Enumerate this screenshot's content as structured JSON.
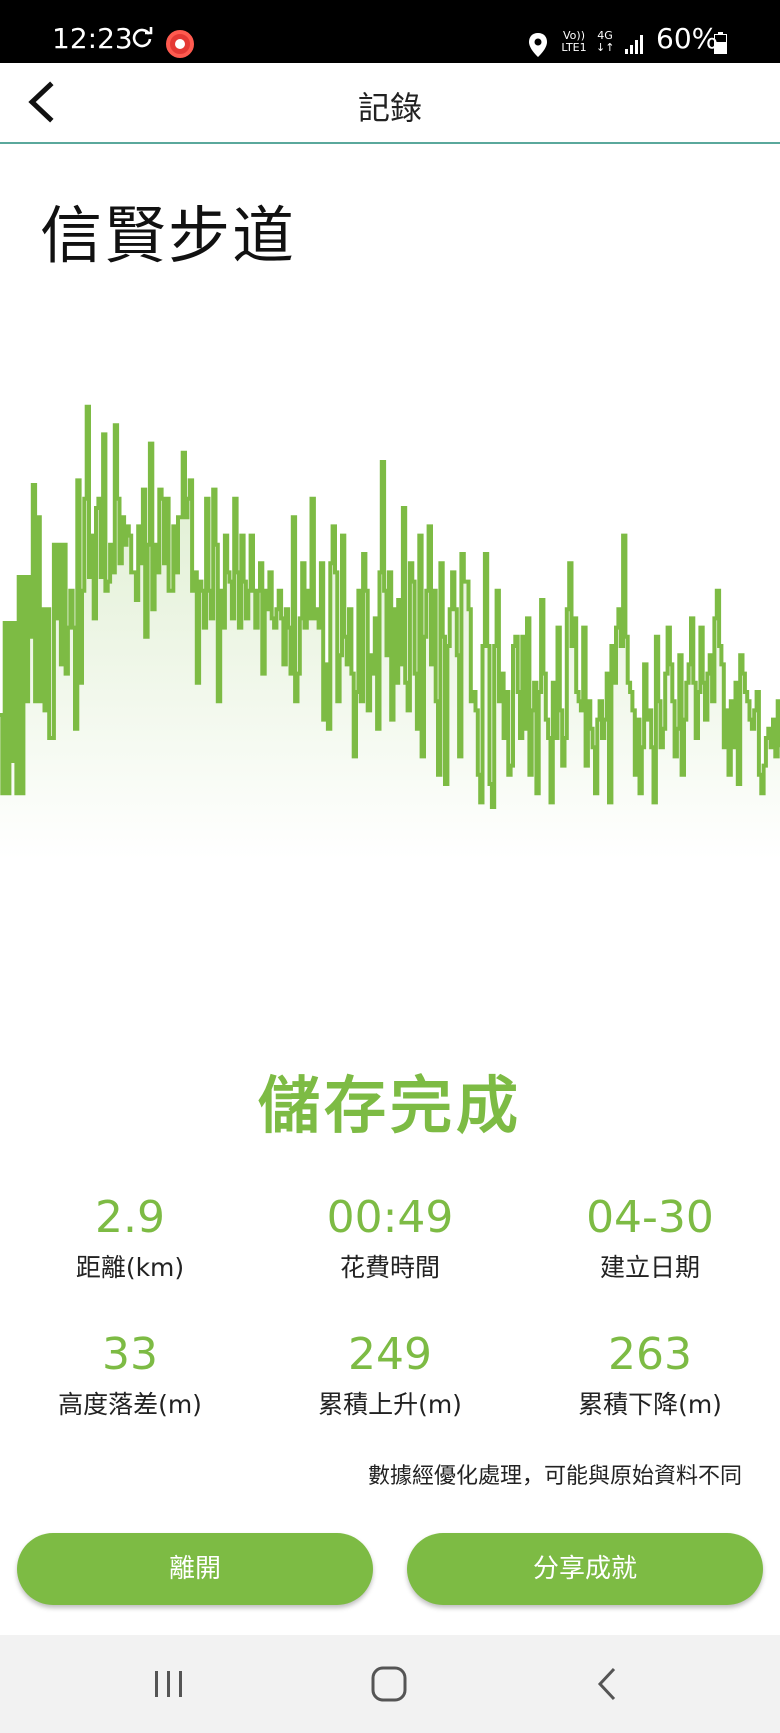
{
  "status_bar": {
    "time": "12:23",
    "volte_line1": "Vo))",
    "volte_line2": "LTE1",
    "network_line1": "4G",
    "network_line2": "↓↑",
    "battery": "60%"
  },
  "header": {
    "title": "記錄"
  },
  "route": {
    "name": "信賢步道"
  },
  "status_heading": "儲存完成",
  "stats": [
    {
      "value": "2.9",
      "label": "距離(km)"
    },
    {
      "value": "00:49",
      "label": "花費時間"
    },
    {
      "value": "04-30",
      "label": "建立日期"
    },
    {
      "value": "33",
      "label": "高度落差(m)"
    },
    {
      "value": "249",
      "label": "累積上升(m)"
    },
    {
      "value": "263",
      "label": "累積下降(m)"
    }
  ],
  "note": "數據經優化處理，可能與原始資料不同",
  "buttons": {
    "leave": "離開",
    "share": "分享成就"
  },
  "colors": {
    "accent": "#7dbb44",
    "header_divider": "#5aa89c",
    "status_bar": "#000000",
    "nav_bar": "#f2f2f2"
  },
  "icons": [
    "sync-icon",
    "record-icon",
    "location-icon",
    "signal-icon",
    "battery-icon",
    "back-arrow-icon",
    "recent-apps-icon",
    "home-icon",
    "nav-back-icon"
  ],
  "chart_data": {
    "type": "area",
    "values": [
      0.25,
      0.08,
      0.45,
      0.08,
      0.45,
      0.15,
      0.45,
      0.08,
      0.55,
      0.08,
      0.55,
      0.28,
      0.55,
      0.42,
      0.75,
      0.28,
      0.68,
      0.28,
      0.48,
      0.26,
      0.48,
      0.2,
      0.2,
      0.62,
      0.46,
      0.62,
      0.36,
      0.62,
      0.34,
      0.44,
      0.52,
      0.44,
      0.22,
      0.76,
      0.32,
      0.52,
      0.72,
      0.92,
      0.55,
      0.64,
      0.46,
      0.7,
      0.72,
      0.55,
      0.86,
      0.52,
      0.54,
      0.62,
      0.56,
      0.88,
      0.72,
      0.58,
      0.68,
      0.62,
      0.66,
      0.64,
      0.56,
      0.56,
      0.5,
      0.66,
      0.58,
      0.74,
      0.42,
      0.62,
      0.84,
      0.48,
      0.62,
      0.56,
      0.74,
      0.72,
      0.58,
      0.72,
      0.52,
      0.52,
      0.66,
      0.56,
      0.68,
      0.68,
      0.82,
      0.68,
      0.72,
      0.76,
      0.52,
      0.56,
      0.32,
      0.54,
      0.52,
      0.44,
      0.72,
      0.52,
      0.46,
      0.74,
      0.62,
      0.28,
      0.52,
      0.44,
      0.64,
      0.56,
      0.54,
      0.46,
      0.72,
      0.56,
      0.44,
      0.64,
      0.54,
      0.46,
      0.52,
      0.64,
      0.52,
      0.44,
      0.52,
      0.58,
      0.34,
      0.52,
      0.48,
      0.56,
      0.46,
      0.44,
      0.48,
      0.52,
      0.46,
      0.36,
      0.48,
      0.44,
      0.34,
      0.68,
      0.28,
      0.34,
      0.46,
      0.58,
      0.44,
      0.52,
      0.46,
      0.72,
      0.46,
      0.48,
      0.44,
      0.58,
      0.24,
      0.36,
      0.22,
      0.58,
      0.66,
      0.56,
      0.28,
      0.38,
      0.64,
      0.42,
      0.36,
      0.48,
      0.34,
      0.16,
      0.3,
      0.52,
      0.28,
      0.6,
      0.52,
      0.26,
      0.38,
      0.34,
      0.46,
      0.22,
      0.56,
      0.8,
      0.52,
      0.38,
      0.56,
      0.24,
      0.48,
      0.32,
      0.5,
      0.36,
      0.7,
      0.32,
      0.26,
      0.58,
      0.54,
      0.34,
      0.22,
      0.64,
      0.16,
      0.42,
      0.52,
      0.66,
      0.36,
      0.52,
      0.28,
      0.12,
      0.58,
      0.42,
      0.1,
      0.4,
      0.48,
      0.56,
      0.48,
      0.38,
      0.16,
      0.6,
      0.54,
      0.54,
      0.48,
      0.28,
      0.3,
      0.26,
      0.12,
      0.06,
      0.4,
      0.6,
      0.4,
      0.1,
      0.05,
      0.4,
      0.52,
      0.28,
      0.34,
      0.2,
      0.3,
      0.12,
      0.14,
      0.4,
      0.42,
      0.3,
      0.2,
      0.42,
      0.22,
      0.46,
      0.12,
      0.26,
      0.32,
      0.08,
      0.3,
      0.5,
      0.34,
      0.24,
      0.2,
      0.06,
      0.32,
      0.2,
      0.44,
      0.26,
      0.14,
      0.2,
      0.48,
      0.58,
      0.4,
      0.46,
      0.3,
      0.28,
      0.26,
      0.44,
      0.14,
      0.28,
      0.22,
      0.18,
      0.08,
      0.24,
      0.28,
      0.2,
      0.24,
      0.34,
      0.06,
      0.4,
      0.32,
      0.44,
      0.48,
      0.4,
      0.64,
      0.42,
      0.32,
      0.3,
      0.26,
      0.12,
      0.24,
      0.08,
      0.18,
      0.36,
      0.24,
      0.26,
      0.18,
      0.06,
      0.42,
      0.28,
      0.18,
      0.22,
      0.34,
      0.44,
      0.36,
      0.28,
      0.16,
      0.22,
      0.38,
      0.12,
      0.24,
      0.32,
      0.36,
      0.46,
      0.32,
      0.2,
      0.3,
      0.44,
      0.32,
      0.24,
      0.34,
      0.38,
      0.28,
      0.46,
      0.52,
      0.4,
      0.36,
      0.18,
      0.26,
      0.12,
      0.28,
      0.18,
      0.32,
      0.1,
      0.38,
      0.34,
      0.3,
      0.28,
      0.24,
      0.22,
      0.26,
      0.3,
      0.12,
      0.08,
      0.14,
      0.2,
      0.22,
      0.18,
      0.24,
      0.16,
      0.28,
      0.18
    ]
  }
}
